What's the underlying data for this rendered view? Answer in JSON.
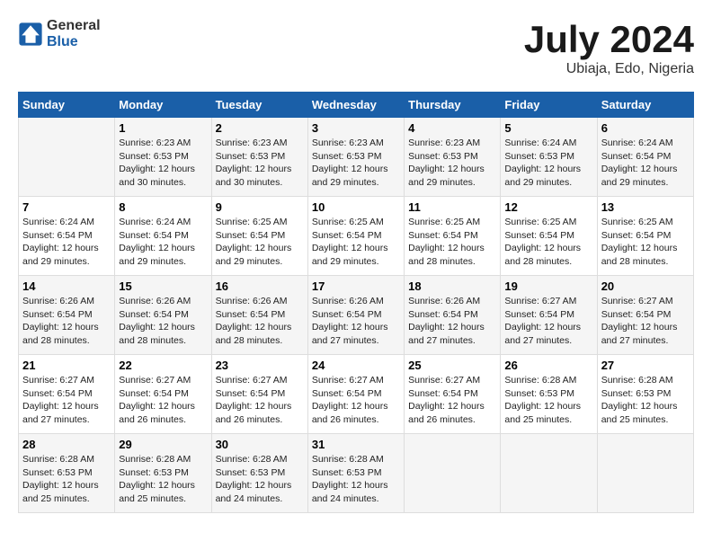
{
  "header": {
    "logo_general": "General",
    "logo_blue": "Blue",
    "title": "July 2024",
    "subtitle": "Ubiaja, Edo, Nigeria"
  },
  "days_of_week": [
    "Sunday",
    "Monday",
    "Tuesday",
    "Wednesday",
    "Thursday",
    "Friday",
    "Saturday"
  ],
  "weeks": [
    [
      {
        "day": "",
        "info": ""
      },
      {
        "day": "1",
        "info": "Sunrise: 6:23 AM\nSunset: 6:53 PM\nDaylight: 12 hours\nand 30 minutes."
      },
      {
        "day": "2",
        "info": "Sunrise: 6:23 AM\nSunset: 6:53 PM\nDaylight: 12 hours\nand 30 minutes."
      },
      {
        "day": "3",
        "info": "Sunrise: 6:23 AM\nSunset: 6:53 PM\nDaylight: 12 hours\nand 29 minutes."
      },
      {
        "day": "4",
        "info": "Sunrise: 6:23 AM\nSunset: 6:53 PM\nDaylight: 12 hours\nand 29 minutes."
      },
      {
        "day": "5",
        "info": "Sunrise: 6:24 AM\nSunset: 6:53 PM\nDaylight: 12 hours\nand 29 minutes."
      },
      {
        "day": "6",
        "info": "Sunrise: 6:24 AM\nSunset: 6:54 PM\nDaylight: 12 hours\nand 29 minutes."
      }
    ],
    [
      {
        "day": "7",
        "info": ""
      },
      {
        "day": "8",
        "info": "Sunrise: 6:24 AM\nSunset: 6:54 PM\nDaylight: 12 hours\nand 29 minutes."
      },
      {
        "day": "9",
        "info": "Sunrise: 6:25 AM\nSunset: 6:54 PM\nDaylight: 12 hours\nand 29 minutes."
      },
      {
        "day": "10",
        "info": "Sunrise: 6:25 AM\nSunset: 6:54 PM\nDaylight: 12 hours\nand 29 minutes."
      },
      {
        "day": "11",
        "info": "Sunrise: 6:25 AM\nSunset: 6:54 PM\nDaylight: 12 hours\nand 28 minutes."
      },
      {
        "day": "12",
        "info": "Sunrise: 6:25 AM\nSunset: 6:54 PM\nDaylight: 12 hours\nand 28 minutes."
      },
      {
        "day": "13",
        "info": "Sunrise: 6:25 AM\nSunset: 6:54 PM\nDaylight: 12 hours\nand 28 minutes."
      }
    ],
    [
      {
        "day": "14",
        "info": ""
      },
      {
        "day": "15",
        "info": "Sunrise: 6:26 AM\nSunset: 6:54 PM\nDaylight: 12 hours\nand 28 minutes."
      },
      {
        "day": "16",
        "info": "Sunrise: 6:26 AM\nSunset: 6:54 PM\nDaylight: 12 hours\nand 28 minutes."
      },
      {
        "day": "17",
        "info": "Sunrise: 6:26 AM\nSunset: 6:54 PM\nDaylight: 12 hours\nand 27 minutes."
      },
      {
        "day": "18",
        "info": "Sunrise: 6:26 AM\nSunset: 6:54 PM\nDaylight: 12 hours\nand 27 minutes."
      },
      {
        "day": "19",
        "info": "Sunrise: 6:27 AM\nSunset: 6:54 PM\nDaylight: 12 hours\nand 27 minutes."
      },
      {
        "day": "20",
        "info": "Sunrise: 6:27 AM\nSunset: 6:54 PM\nDaylight: 12 hours\nand 27 minutes."
      }
    ],
    [
      {
        "day": "21",
        "info": ""
      },
      {
        "day": "22",
        "info": "Sunrise: 6:27 AM\nSunset: 6:54 PM\nDaylight: 12 hours\nand 26 minutes."
      },
      {
        "day": "23",
        "info": "Sunrise: 6:27 AM\nSunset: 6:54 PM\nDaylight: 12 hours\nand 26 minutes."
      },
      {
        "day": "24",
        "info": "Sunrise: 6:27 AM\nSunset: 6:54 PM\nDaylight: 12 hours\nand 26 minutes."
      },
      {
        "day": "25",
        "info": "Sunrise: 6:27 AM\nSunset: 6:54 PM\nDaylight: 12 hours\nand 26 minutes."
      },
      {
        "day": "26",
        "info": "Sunrise: 6:28 AM\nSunset: 6:53 PM\nDaylight: 12 hours\nand 25 minutes."
      },
      {
        "day": "27",
        "info": "Sunrise: 6:28 AM\nSunset: 6:53 PM\nDaylight: 12 hours\nand 25 minutes."
      }
    ],
    [
      {
        "day": "28",
        "info": "Sunrise: 6:28 AM\nSunset: 6:53 PM\nDaylight: 12 hours\nand 25 minutes."
      },
      {
        "day": "29",
        "info": "Sunrise: 6:28 AM\nSunset: 6:53 PM\nDaylight: 12 hours\nand 25 minutes."
      },
      {
        "day": "30",
        "info": "Sunrise: 6:28 AM\nSunset: 6:53 PM\nDaylight: 12 hours\nand 24 minutes."
      },
      {
        "day": "31",
        "info": "Sunrise: 6:28 AM\nSunset: 6:53 PM\nDaylight: 12 hours\nand 24 minutes."
      },
      {
        "day": "",
        "info": ""
      },
      {
        "day": "",
        "info": ""
      },
      {
        "day": "",
        "info": ""
      }
    ]
  ],
  "week1_day7_info": "Sunrise: 6:24 AM\nSunset: 6:54 PM\nDaylight: 12 hours\nand 29 minutes.",
  "week3_day14_info": "Sunrise: 6:26 AM\nSunset: 6:54 PM\nDaylight: 12 hours\nand 28 minutes.",
  "week4_day21_info": "Sunrise: 6:27 AM\nSunset: 6:54 PM\nDaylight: 12 hours\nand 27 minutes."
}
